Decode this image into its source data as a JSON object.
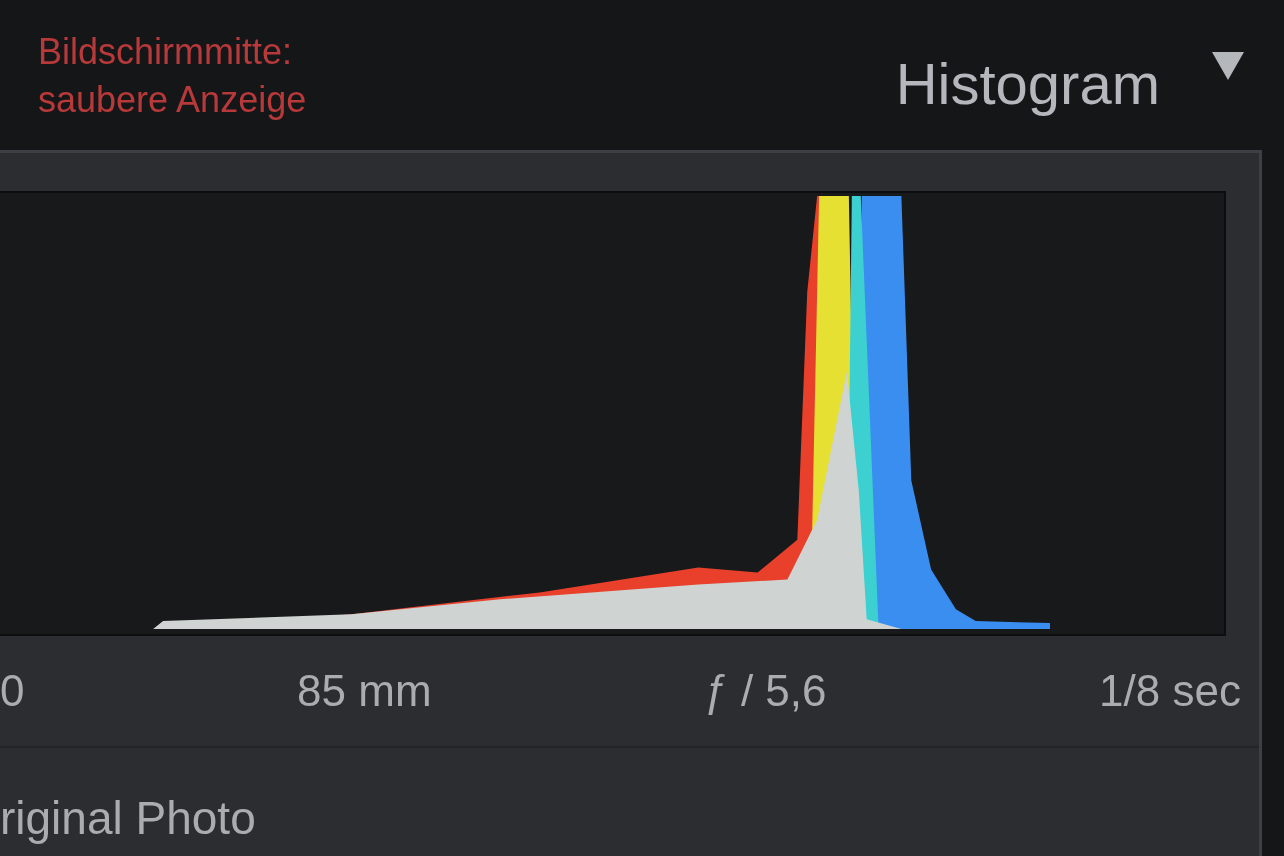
{
  "annotation": "Bildschirmmitte:\nsaubere Anzeige",
  "panel": {
    "title": "Histogram",
    "expanded": true
  },
  "exif": [
    "0",
    "85 mm",
    "ƒ / 5,6",
    "1/8 sec"
  ],
  "footer_label": "riginal Photo"
}
